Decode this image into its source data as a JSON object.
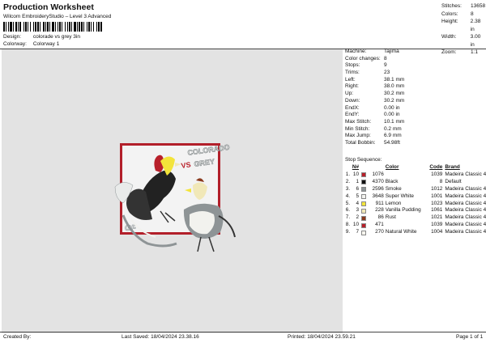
{
  "header": {
    "title": "Production Worksheet",
    "subtitle": "Wilcom EmbroideryStudio – Level 3 Advanced",
    "design_label": "Design:",
    "design_value": "colorade vs grey 3in",
    "colorway_label": "Colorway:",
    "colorway_value": "Colorway 1"
  },
  "summary": [
    {
      "k": "Stitches:",
      "v": "13658"
    },
    {
      "k": "Colors:",
      "v": "8"
    },
    {
      "k": "Height:",
      "v": "2.38 in"
    },
    {
      "k": "Width:",
      "v": "3.00 in"
    },
    {
      "k": "Zoom:",
      "v": "1:1"
    }
  ],
  "design_image": {
    "text_top": "COLORADO",
    "text_vs": "VS",
    "text_bottom": "GREY",
    "logo": "GF"
  },
  "machine_info": [
    {
      "k": "Machine:",
      "v": "Tajima"
    },
    {
      "k": "Color changes:",
      "v": "8"
    },
    {
      "k": "Stops:",
      "v": "9"
    },
    {
      "k": "Trims:",
      "v": "23"
    },
    {
      "k": "Left:",
      "v": "38.1 mm"
    },
    {
      "k": "Right:",
      "v": "38.0 mm"
    },
    {
      "k": "Up:",
      "v": "30.2 mm"
    },
    {
      "k": "Down:",
      "v": "30.2 mm"
    },
    {
      "k": "EndX:",
      "v": "0.00 in"
    },
    {
      "k": "EndY:",
      "v": "0.00 in"
    },
    {
      "k": "Max Stitch:",
      "v": "10.1 mm"
    },
    {
      "k": "Min Stitch:",
      "v": "0.2 mm"
    },
    {
      "k": "Max Jump:",
      "v": "6.9 mm"
    },
    {
      "k": "Total Bobbin:",
      "v": "54.98ft"
    }
  ],
  "stop_sequence": {
    "label": "Stop Sequence:",
    "headers": {
      "n": "N#",
      "color": "Color",
      "name": "Name",
      "code": "Code",
      "brand": "Brand"
    },
    "rows": [
      {
        "idx": "1.",
        "stop": "10",
        "color": "#b8202a",
        "stitches": "1076",
        "name": "",
        "code": "1039",
        "brand": "Madeira Classic 40"
      },
      {
        "idx": "2.",
        "stop": "1",
        "color": "#111111",
        "stitches": "4370",
        "name": "Black",
        "code": "8",
        "brand": "Default"
      },
      {
        "idx": "3.",
        "stop": "6",
        "color": "#8e9496",
        "stitches": "2596",
        "name": "Smoke",
        "code": "1012",
        "brand": "Madeira Classic 40"
      },
      {
        "idx": "4.",
        "stop": "5",
        "color": "#f2f2ee",
        "stitches": "3648",
        "name": "Super White",
        "code": "1001",
        "brand": "Madeira Classic 40"
      },
      {
        "idx": "5.",
        "stop": "4",
        "color": "#f3e43a",
        "stitches": "911",
        "name": "Lemon",
        "code": "1023",
        "brand": "Madeira Classic 40"
      },
      {
        "idx": "6.",
        "stop": "3",
        "color": "#f1e8b8",
        "stitches": "228",
        "name": "Vanilla Pudding",
        "code": "1061",
        "brand": "Madeira Classic 40"
      },
      {
        "idx": "7.",
        "stop": "2",
        "color": "#8a3a1e",
        "stitches": "86",
        "name": "Rust",
        "code": "1021",
        "brand": "Madeira Classic 40"
      },
      {
        "idx": "8.",
        "stop": "10",
        "color": "#b8202a",
        "stitches": "471",
        "name": "",
        "code": "1039",
        "brand": "Madeira Classic 40"
      },
      {
        "idx": "9.",
        "stop": "7",
        "color": "#f7f5ee",
        "stitches": "270",
        "name": "Natural White",
        "code": "1004",
        "brand": "Madeira Classic 40"
      }
    ]
  },
  "footer": {
    "created_by": "Created By:",
    "last_saved": "Last Saved: 18/04/2024 23.38.16",
    "printed": "Printed: 18/04/2024 23.59.21",
    "page": "Page 1 of 1"
  }
}
